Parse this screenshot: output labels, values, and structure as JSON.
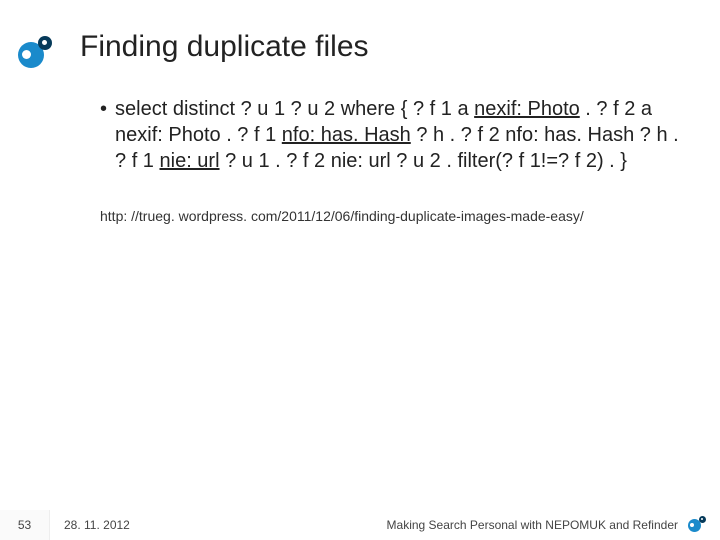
{
  "title": "Finding duplicate files",
  "bullet": {
    "marker": "•",
    "parts": {
      "p1": "select distinct ? u 1 ? u 2 where { ? f 1 a ",
      "l1": "nexif: Photo",
      "p2": " . ? f 2 a nexif: Photo . ? f 1 ",
      "l2": "nfo: has. Hash",
      "p3": " ? h . ? f 2 nfo: has. Hash ? h . ? f 1 ",
      "l3": "nie: url",
      "p4": " ? u 1 . ? f 2 nie: url ? u 2 . filter(? f 1!=? f 2) . }"
    }
  },
  "source_url": "http: //trueg. wordpress. com/2011/12/06/finding-duplicate-images-made-easy/",
  "footer": {
    "slide_number": "53",
    "date": "28. 11. 2012",
    "presentation_title": "Making Search Personal with NEPOMUK and Refinder"
  }
}
